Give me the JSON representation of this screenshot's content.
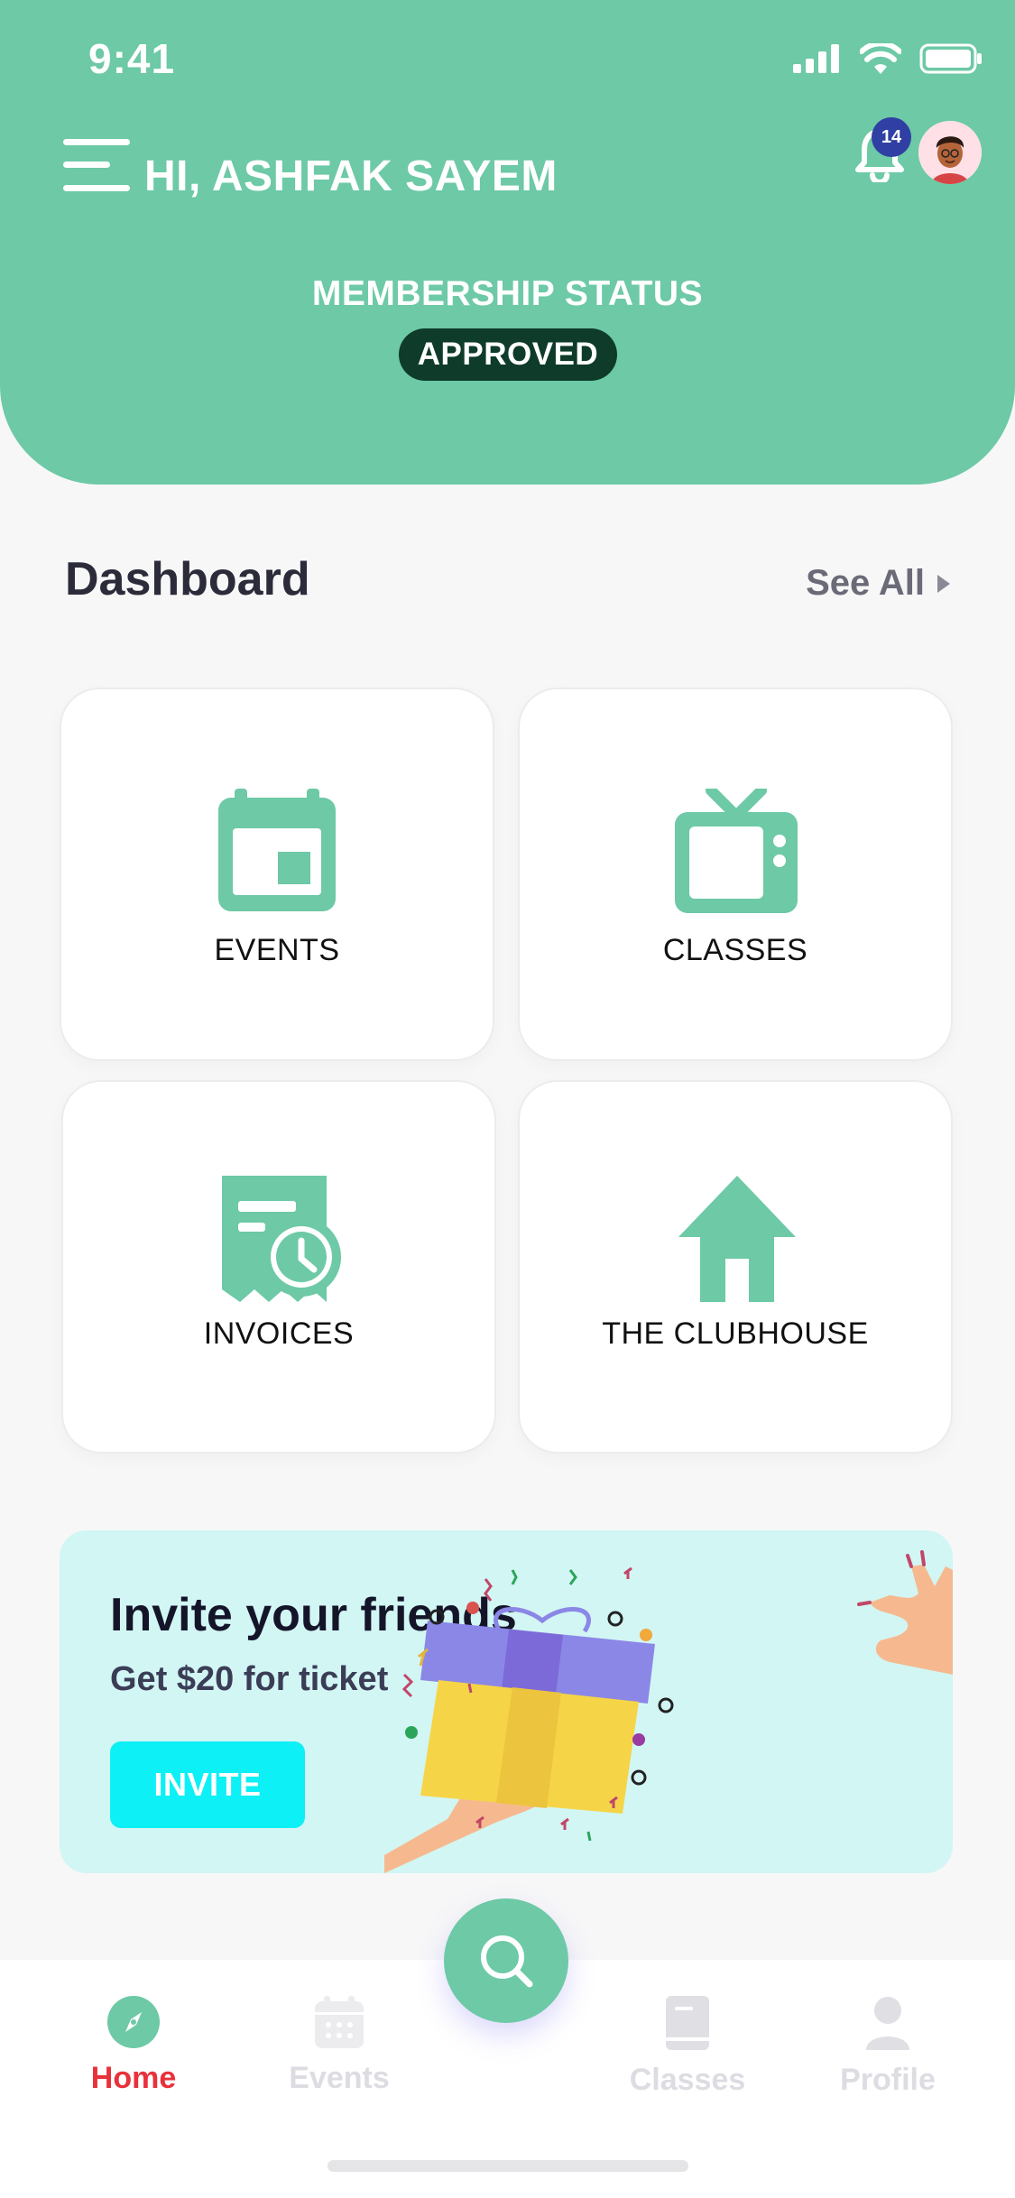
{
  "status_bar": {
    "time": "9:41"
  },
  "header": {
    "greeting": "HI, ASHFAK SAYEM",
    "notification_count": "14",
    "membership_title": "MEMBERSHIP STATUS",
    "membership_status": "APPROVED"
  },
  "dashboard": {
    "title": "Dashboard",
    "see_all": "See All",
    "cards": [
      {
        "label": "EVENTS",
        "icon": "calendar-icon"
      },
      {
        "label": "CLASSES",
        "icon": "tv-icon"
      },
      {
        "label": "INVOICES",
        "icon": "invoice-clock-icon"
      },
      {
        "label": "THE CLUBHOUSE",
        "icon": "house-icon"
      }
    ]
  },
  "invite": {
    "title": "Invite your friends",
    "subtitle": "Get $20 for ticket",
    "button": "INVITE"
  },
  "tabbar": {
    "items": [
      {
        "label": "Home",
        "icon": "compass-icon",
        "active": true
      },
      {
        "label": "Events",
        "icon": "calendar-icon",
        "active": false
      },
      {
        "label": "Classes",
        "icon": "book-icon",
        "active": false
      },
      {
        "label": "Profile",
        "icon": "person-icon",
        "active": false
      }
    ],
    "fab_icon": "search-icon"
  },
  "colors": {
    "primary": "#6dc9a6",
    "dark_green": "#0e3b2a",
    "active_tab": "#e8313b",
    "invite_bg": "#d2f6f4",
    "invite_button": "#0df0f6"
  }
}
